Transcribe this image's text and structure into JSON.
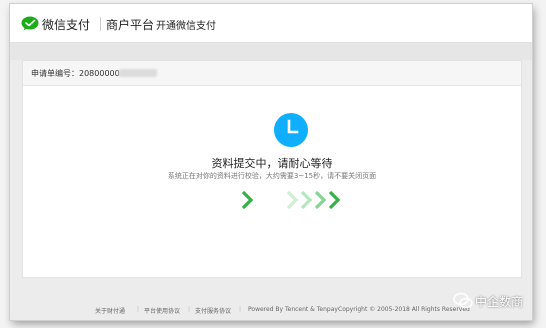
{
  "header": {
    "brand": "微信支付",
    "platform": "商户平台",
    "page": "开通微信支付"
  },
  "application": {
    "label": "申请单编号：20800000"
  },
  "status": {
    "title": "资料提交中，请耐心等待",
    "description": "系统正在对你的资料进行校验，大约需要3~15秒，请不要关闭页面"
  },
  "footer": {
    "about": "关于财付通",
    "agreement": "平台使用协议",
    "service": "支付服务协议",
    "powered": "Powered By Tencent & Tenpay",
    "copyright": "Copyright © 2005-2018 All Rights Reserved"
  },
  "watermark": {
    "text": "中企数商"
  },
  "colors": {
    "wechat_green": "#1aad19",
    "clock_blue": "#10aeff",
    "arrow_green": "#35b145",
    "arrow_faded": "#bfe8c4"
  }
}
